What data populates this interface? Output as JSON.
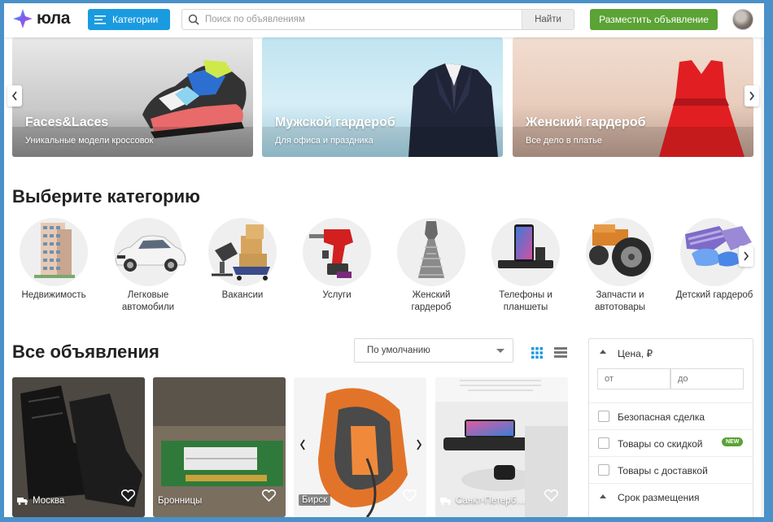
{
  "header": {
    "logo_text": "юла",
    "categories_button": "Категории",
    "search_placeholder": "Поиск по объявлениям",
    "search_button": "Найти",
    "post_button": "Разместить объявление"
  },
  "banners": [
    {
      "title": "Faces&Laces",
      "subtitle": "Уникальные модели кроссовок"
    },
    {
      "title": "Мужской гардероб",
      "subtitle": "Для офиса и праздника"
    },
    {
      "title": "Женский гардероб",
      "subtitle": "Все дело в платье"
    }
  ],
  "categories_section": {
    "title": "Выберите категорию",
    "items": [
      {
        "label": "Недвижимость",
        "icon": "building-icon"
      },
      {
        "label": "Легковые\nавтомобили",
        "icon": "car-icon"
      },
      {
        "label": "Вакансии",
        "icon": "office-chair-icon"
      },
      {
        "label": "Услуги",
        "icon": "drill-icon"
      },
      {
        "label": "Женский\nгардероб",
        "icon": "dress-icon"
      },
      {
        "label": "Телефоны и\nпланшеты",
        "icon": "phone-icon"
      },
      {
        "label": "Запчасти и\nавтотовары",
        "icon": "wheel-icon"
      },
      {
        "label": "Детский гардероб",
        "icon": "kids-clothes-icon"
      }
    ]
  },
  "listings_section": {
    "title": "Все объявления",
    "sort_value": "По умолчанию",
    "cards": [
      {
        "location": "Москва",
        "delivery": true
      },
      {
        "location": "Бронницы",
        "delivery": false
      },
      {
        "location": "Бирск",
        "delivery": false
      },
      {
        "location": "Санкт-Петерб…",
        "delivery": true
      }
    ]
  },
  "filters": {
    "price_title": "Цена, ₽",
    "price_from_placeholder": "от",
    "price_to_placeholder": "до",
    "safe_deal": "Безопасная сделка",
    "discount": "Товары со скидкой",
    "new_badge": "NEW",
    "delivery": "Товары с доставкой",
    "posting_period": "Срок размещения"
  },
  "colors": {
    "accent_blue": "#1a9be0",
    "accent_green": "#5aa334"
  }
}
